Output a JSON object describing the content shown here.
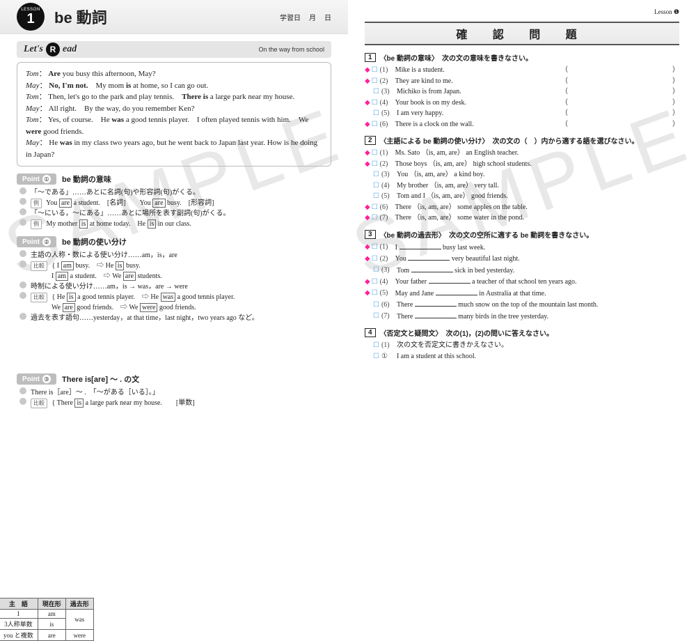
{
  "left": {
    "lesson_label": "LESSON",
    "lesson_num": "1",
    "title": "be 動詞",
    "date_label": "学習日",
    "date_month": "月",
    "date_day": "日",
    "lets": "Let's",
    "read": "ead",
    "subtitle": "On the way from school",
    "dialog": [
      "Tom： <b>Are</b> you busy this afternoon, May?",
      "May： <b>No, I'm not.</b>　My mom <b>is</b> at home, so I can go out.",
      "Tom： Then, let's go to the park and play tennis.　<b>There is</b> a large park near my house.",
      "May： All right.　By the way, do you remember Ken?",
      "Tom： Yes, of course.　He <b>was</b> a good tennis player.　I often played tennis with him.　We <b>were</b> good friends.",
      "May： He <b>was</b> in my class two years ago, but he went back to Japan last year. How is he doing in Japan?"
    ],
    "point1": {
      "pill": "Point",
      "num": "①",
      "title": "be 動詞の意味",
      "lines": [
        "「～である」……あとに名詞(句)や形容詞(句)がくる。",
        "<span class='exbox'>例</span> You <span class='box'>are</span> a student.　[名詞]　　You <span class='box'>are</span> busy.　[形容詞]",
        "「～にいる，～にある」……あとに場所を表す副詞(句)がくる。",
        "<span class='exbox'>例</span> My mother <span class='box'>is</span> at home today.　He <span class='box'>is</span> in our class."
      ]
    },
    "point2": {
      "pill": "Point",
      "num": "②",
      "title": "be 動詞の使い分け",
      "lines": [
        "主語の人称・数による使い分け……am，is，are",
        "<span class='exbox'>比較</span> { I <span class='box'>am</span> busy.　⇨ He <span class='box'>is</span> busy.<br>　　　I <span class='box'>am</span> a student.　⇨ We <span class='box'>are</span> students.",
        "時制による使い分け……am，is → was，are → were",
        "<span class='exbox'>比較</span> { He <span class='box'>is</span> a good tennis player.　⇨ He <span class='box'>was</span> a good tennis player.<br>　　　We <span class='box'>are</span> good friends.　⇨ We <span class='box'>were</span> good friends.",
        "過去を表す語句……yesterday，at that time，last night，two years ago など。"
      ]
    },
    "verb_table": {
      "h": [
        "主　語",
        "現在形",
        "過去形"
      ],
      "r": [
        [
          "I",
          "am",
          "was"
        ],
        [
          "3人称単数",
          "is",
          ""
        ],
        [
          "you と複数",
          "are",
          "were"
        ]
      ]
    },
    "point3": {
      "pill": "Point",
      "num": "③",
      "title": "There is[are] ～ . の文",
      "lines": [
        "There is［are］～ .　「～がある［いる］。」",
        "<span class='exbox'>比較</span> { There <span class='box'>is</span> a large park near my house.　　[単数]"
      ]
    }
  },
  "right": {
    "lesson_tag": "Lesson ❶",
    "kakunin": "確 認 問 題",
    "s1": {
      "num": "1",
      "title": "〈be 動詞の意味〉　次の文の意味を書きなさい。",
      "items": [
        {
          "m": "◆",
          "n": "(1)",
          "t": "Mike is a student."
        },
        {
          "m": "◆",
          "n": "(2)",
          "t": "They are kind to me."
        },
        {
          "m": "",
          "n": "(3)",
          "t": "Michiko is from Japan."
        },
        {
          "m": "◆",
          "n": "(4)",
          "t": "Your book is on my desk."
        },
        {
          "m": "",
          "n": "(5)",
          "t": "I am very happy."
        },
        {
          "m": "◆",
          "n": "(6)",
          "t": "There is a clock on the wall."
        }
      ]
    },
    "s2": {
      "num": "2",
      "title": "〈主語による be 動詞の使い分け〉　次の文の（　）内から適する語を選びなさい。",
      "items": [
        {
          "m": "◆",
          "n": "(1)",
          "t": "Ms. Sato （is, am, are） an English teacher."
        },
        {
          "m": "◆",
          "n": "(2)",
          "t": "Those boys （is, am, are） high school students."
        },
        {
          "m": "",
          "n": "(3)",
          "t": "You （is, am, are） a kind boy."
        },
        {
          "m": "",
          "n": "(4)",
          "t": "My brother （is, am, are） very tall."
        },
        {
          "m": "",
          "n": "(5)",
          "t": "Tom and I （is, am, are） good friends."
        },
        {
          "m": "◆",
          "n": "(6)",
          "t": "There （is, am, are） some apples on the table."
        },
        {
          "m": "◆",
          "n": "(7)",
          "t": "There （is, am, are） some water in the pond."
        }
      ]
    },
    "s3": {
      "num": "3",
      "title": "〈be 動詞の過去形〉　次の文の空所に適する be 動詞を書きなさい。",
      "items": [
        {
          "m": "◆",
          "n": "(1)",
          "t": "I ＿＿＿＿ busy last week."
        },
        {
          "m": "◆",
          "n": "(2)",
          "t": "You ＿＿＿＿ very beautiful last night."
        },
        {
          "m": "",
          "n": "(3)",
          "t": "Tom ＿＿＿＿ sick in bed yesterday."
        },
        {
          "m": "◆",
          "n": "(4)",
          "t": "Your father ＿＿＿＿ a teacher of that school ten years ago."
        },
        {
          "m": "◆",
          "n": "(5)",
          "t": "May and Jane ＿＿＿＿ in Australia at that time."
        },
        {
          "m": "",
          "n": "(6)",
          "t": "There ＿＿＿＿ much snow on the top of the mountain last month."
        },
        {
          "m": "",
          "n": "(7)",
          "t": "There ＿＿＿＿ many birds in the tree yesterday."
        }
      ]
    },
    "s4": {
      "num": "4",
      "title": "〈否定文と疑問文〉　次の(1)，(2)の問いに答えなさい。",
      "items": [
        {
          "m": "",
          "n": "(1)",
          "t": "次の文を否定文に書きかえなさい。"
        },
        {
          "m": "",
          "n": "①",
          "t": "I am a student at this school."
        }
      ]
    }
  }
}
